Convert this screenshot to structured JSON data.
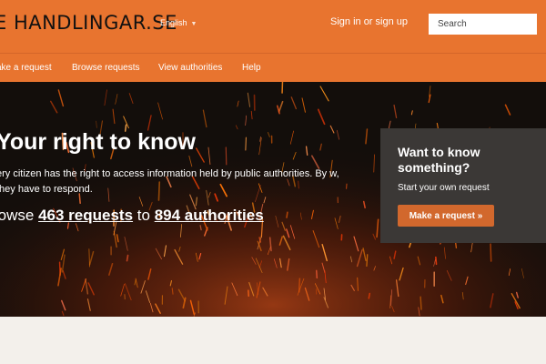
{
  "header": {
    "logo_text": "E HANDLINGAR.SE",
    "language": "English",
    "signin_label": "Sign in or sign up",
    "search_placeholder": "Search"
  },
  "nav": {
    "items": [
      {
        "label": "ake a request"
      },
      {
        "label": "Browse requests"
      },
      {
        "label": "View authorities"
      },
      {
        "label": "Help"
      }
    ]
  },
  "hero": {
    "title": "Your right to know",
    "body": "ery citizen has the right to access information held by public authorities. By w, they have to respond.",
    "browse_prefix": "rowse",
    "requests_link": "463 requests",
    "connector": "to",
    "authorities_link": "894 authorities"
  },
  "cta": {
    "title": "Want to know something?",
    "subtitle": "Start your own request",
    "button_label": "Make a request »"
  },
  "colors": {
    "brand_orange": "#e8742f",
    "hero_bg": "#130e0b",
    "cta_bg": "#3b3836",
    "cta_button": "#d2682d",
    "page_bg": "#f3f0eb"
  }
}
